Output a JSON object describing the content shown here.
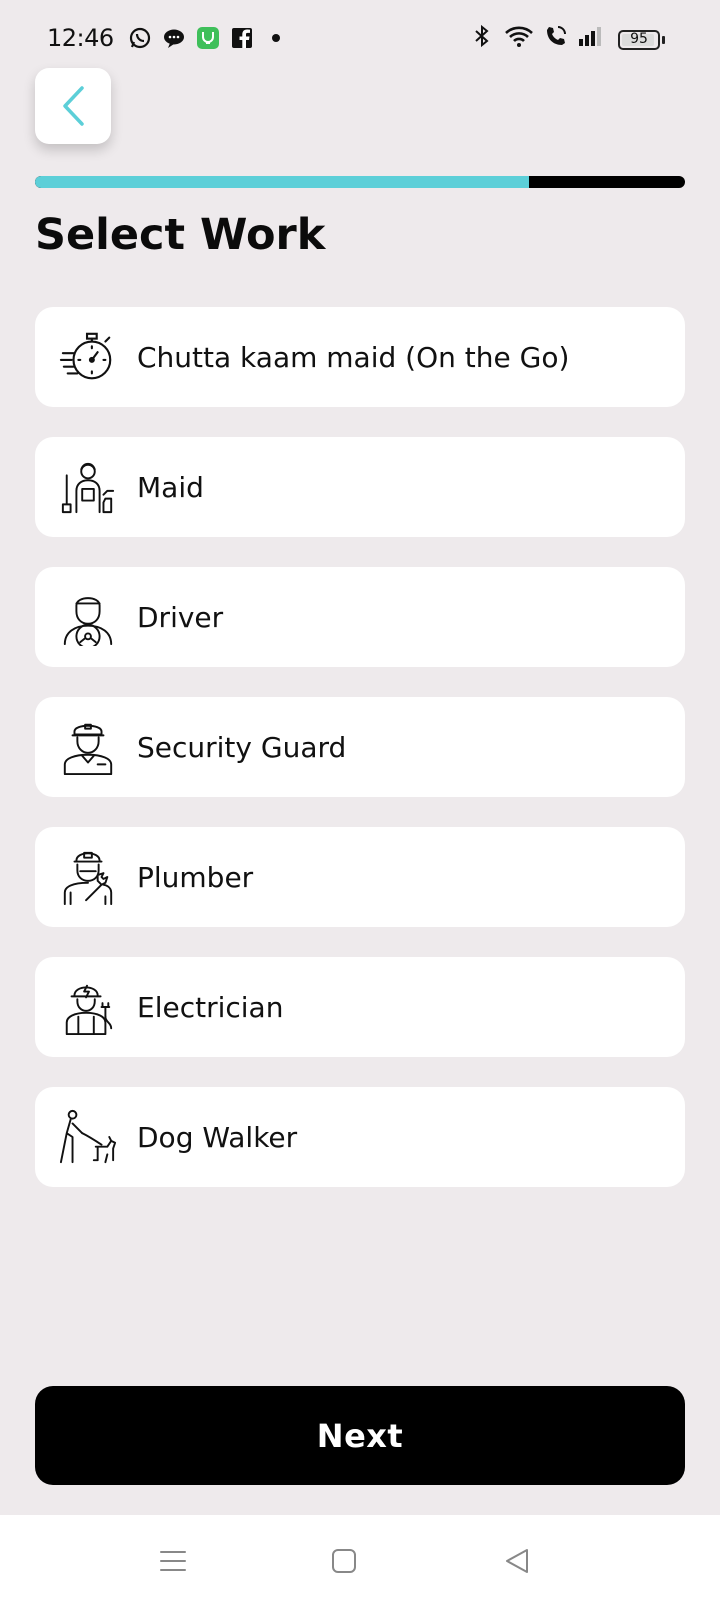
{
  "status_bar": {
    "time": "12:46",
    "left_icons": [
      "whatsapp-icon",
      "chat-bubble-icon",
      "app-store-icon",
      "facebook-icon",
      "dot-icon"
    ],
    "right_icons": [
      "bluetooth-icon",
      "wifi-icon",
      "wifi-call-icon",
      "signal-icon"
    ],
    "battery": "95",
    "battery_level": 0.95
  },
  "header": {
    "back_icon": "chevron-left-icon",
    "progress": 0.76,
    "progress_color": "#5ccfd8"
  },
  "page": {
    "title": "Select Work"
  },
  "work_options": [
    {
      "label": "Chutta kaam maid (On the Go)",
      "icon": "stopwatch-icon"
    },
    {
      "label": "Maid",
      "icon": "maid-icon"
    },
    {
      "label": "Driver",
      "icon": "driver-icon"
    },
    {
      "label": "Security Guard",
      "icon": "security-guard-icon"
    },
    {
      "label": "Plumber",
      "icon": "plumber-icon"
    },
    {
      "label": "Electrician",
      "icon": "electrician-icon"
    },
    {
      "label": "Dog Walker",
      "icon": "dog-walker-icon"
    }
  ],
  "footer": {
    "next_label": "Next"
  },
  "nav_bar": {
    "items": [
      "menu-icon",
      "home-icon",
      "back-icon"
    ]
  }
}
